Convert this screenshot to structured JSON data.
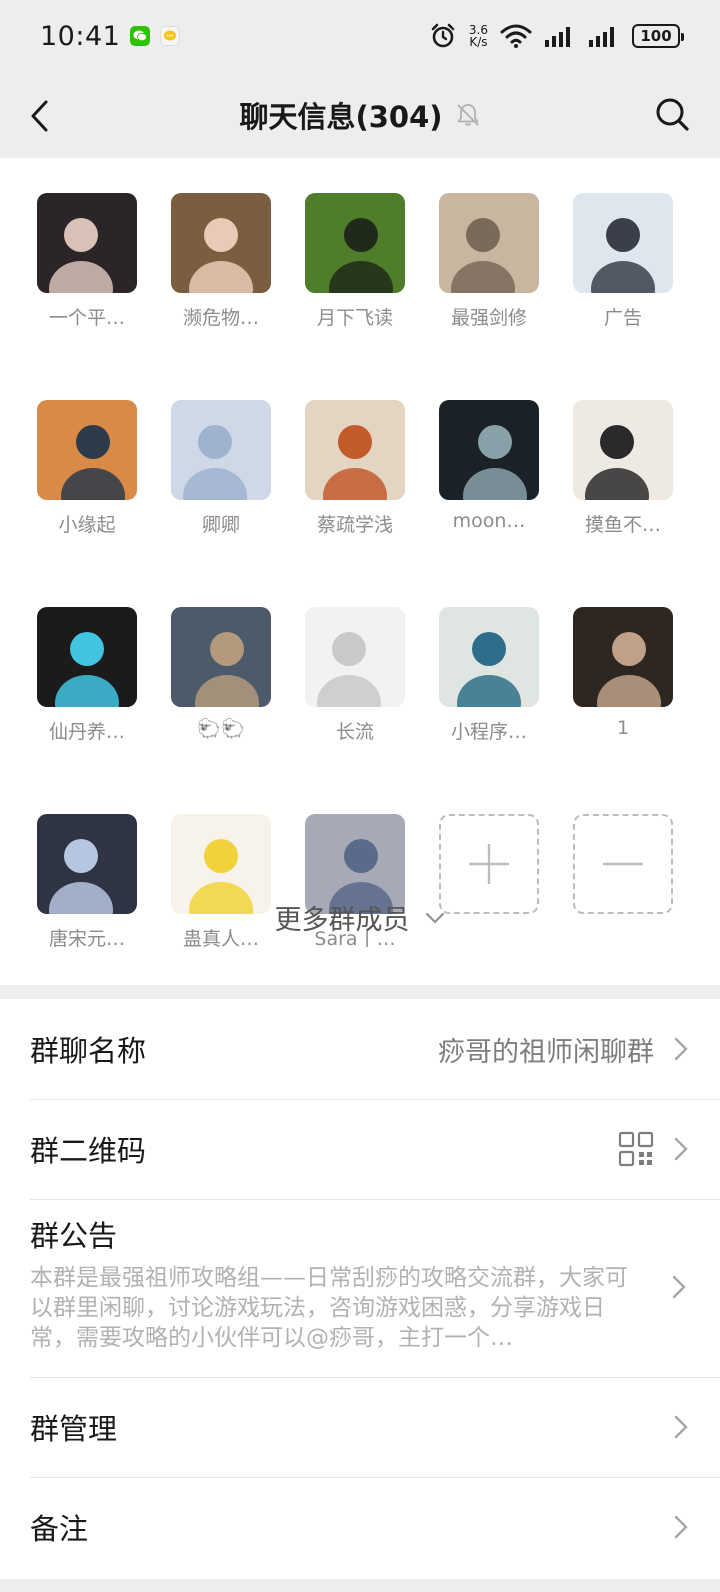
{
  "status_bar": {
    "time": "10:41",
    "net_speed_value": "3.6",
    "net_speed_unit": "K/s",
    "battery": "100"
  },
  "header": {
    "title": "聊天信息(304)"
  },
  "members": [
    {
      "name": "一个平…",
      "palette": [
        "#2b2527",
        "#d8c2b8"
      ]
    },
    {
      "name": "濒危物…",
      "palette": [
        "#7a5e40",
        "#e8cbb6"
      ]
    },
    {
      "name": "月下飞读",
      "palette": [
        "#4f7d2a",
        "#1f2a1a"
      ]
    },
    {
      "name": "最强剑修",
      "palette": [
        "#c9b6a0",
        "#7a6a5a"
      ]
    },
    {
      "name": "广告",
      "palette": [
        "#dfe6ee",
        "#3a3f4a"
      ]
    },
    {
      "name": "小缘起",
      "palette": [
        "#d88a46",
        "#2c3a4a"
      ]
    },
    {
      "name": "卿卿",
      "palette": [
        "#cfd8e6",
        "#9fb3cf"
      ]
    },
    {
      "name": "蔡疏学浅",
      "palette": [
        "#e4d4c2",
        "#c25a2a"
      ]
    },
    {
      "name": "moon…",
      "palette": [
        "#1a2228",
        "#8aa0a8"
      ]
    },
    {
      "name": "摸鱼不…",
      "palette": [
        "#eee9e2",
        "#2a2a2a"
      ]
    },
    {
      "name": "仙丹养…",
      "palette": [
        "#1b1b1b",
        "#40c4e0"
      ]
    },
    {
      "name": "🐑🐑",
      "palette": [
        "#4d5a6a",
        "#b39a7c"
      ]
    },
    {
      "name": "长流",
      "palette": [
        "#f2f2f2",
        "#c9c9c9"
      ]
    },
    {
      "name": "小程序…",
      "palette": [
        "#dfe6e2",
        "#2f6e8a"
      ]
    },
    {
      "name": "1",
      "palette": [
        "#2d2621",
        "#bfa18a"
      ]
    },
    {
      "name": "唐宋元…",
      "palette": [
        "#2f3444",
        "#b7c6e0"
      ]
    },
    {
      "name": "蛊真人…",
      "palette": [
        "#f7f3ea",
        "#f2d23a"
      ]
    },
    {
      "name": "Sara丨…",
      "palette": [
        "#a8a9b6",
        "#5a6a8a"
      ]
    }
  ],
  "more_members_label": "更多群成员",
  "settings": {
    "group_name_label": "群聊名称",
    "group_name_value": "痧哥的祖师闲聊群",
    "qr_label": "群二维码",
    "notice_label": "群公告",
    "notice_text": "本群是最强祖师攻略组——日常刮痧的攻略交流群，大家可以群里闲聊，讨论游戏玩法，咨询游戏困惑，分享游戏日常，需要攻略的小伙伴可以@痧哥，主打一个…",
    "manage_label": "群管理",
    "remark_label": "备注"
  },
  "icons": {
    "back": "back-arrow-icon",
    "search": "search-icon",
    "mute": "mute-bell-icon",
    "add": "plus-icon",
    "remove": "minus-icon",
    "chevron": "chevron-right-icon",
    "qr": "qr-code-icon"
  },
  "colors": {
    "background": "#ededed",
    "panel": "#ffffff",
    "secondary_text": "#8c8c8c"
  }
}
